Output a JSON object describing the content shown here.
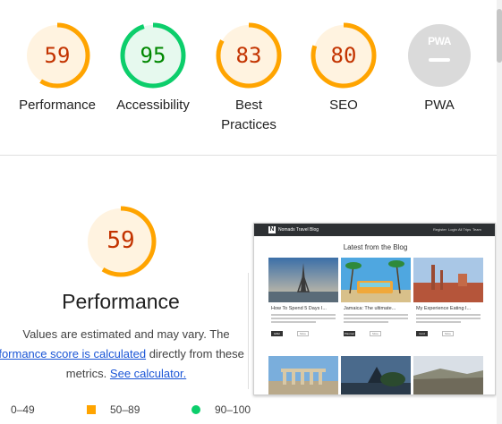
{
  "categories": [
    {
      "score": "59",
      "label": "Performance",
      "value": 0.59,
      "color": "#ffa400",
      "text_color": "#c33300",
      "bg": "#fff3e0"
    },
    {
      "score": "95",
      "label": "Accessibility",
      "value": 0.95,
      "color": "#0cce6b",
      "text_color": "#008800",
      "bg": "#e6f9ee"
    },
    {
      "score": "83",
      "label": "Best",
      "label2": "Practices",
      "value": 0.83,
      "color": "#ffa400",
      "text_color": "#c33300",
      "bg": "#fff3e0"
    },
    {
      "score": "80",
      "label": "SEO",
      "value": 0.8,
      "color": "#ffa400",
      "text_color": "#c33300",
      "bg": "#fff3e0"
    }
  ],
  "pwa": {
    "label": "PWA",
    "badge_text": "PWA"
  },
  "performance": {
    "score": "59",
    "value": 0.59,
    "title": "Performance",
    "desc_line1": "Values are estimated and may vary. The",
    "desc_link": "rformance score is calculated",
    "desc_line2_rest": " directly from these",
    "desc_line3": "metrics. ",
    "desc_link2": "See calculator."
  },
  "legend": {
    "fail": "0–49",
    "average": "50–89",
    "pass": "90–100",
    "colors": {
      "fail": "#ff4e42",
      "average": "#ffa400",
      "pass": "#0cce6b"
    }
  },
  "screenshot": {
    "brand": "Nomads Travel Blog",
    "nav_links": [
      "Register",
      "Login",
      "All Trips",
      "Team"
    ],
    "heading": "Latest from the Blog",
    "cards": [
      {
        "title": "How To Spend 5 Days I...",
        "btn_dark": "Eiffel",
        "btn_light": "More"
      },
      {
        "title": "Jamaica: The ultimate...",
        "btn_dark": "Plasmar",
        "btn_light": "More"
      },
      {
        "title": "My Experience Eating I...",
        "btn_dark": "Cord",
        "btn_light": "More"
      }
    ]
  }
}
